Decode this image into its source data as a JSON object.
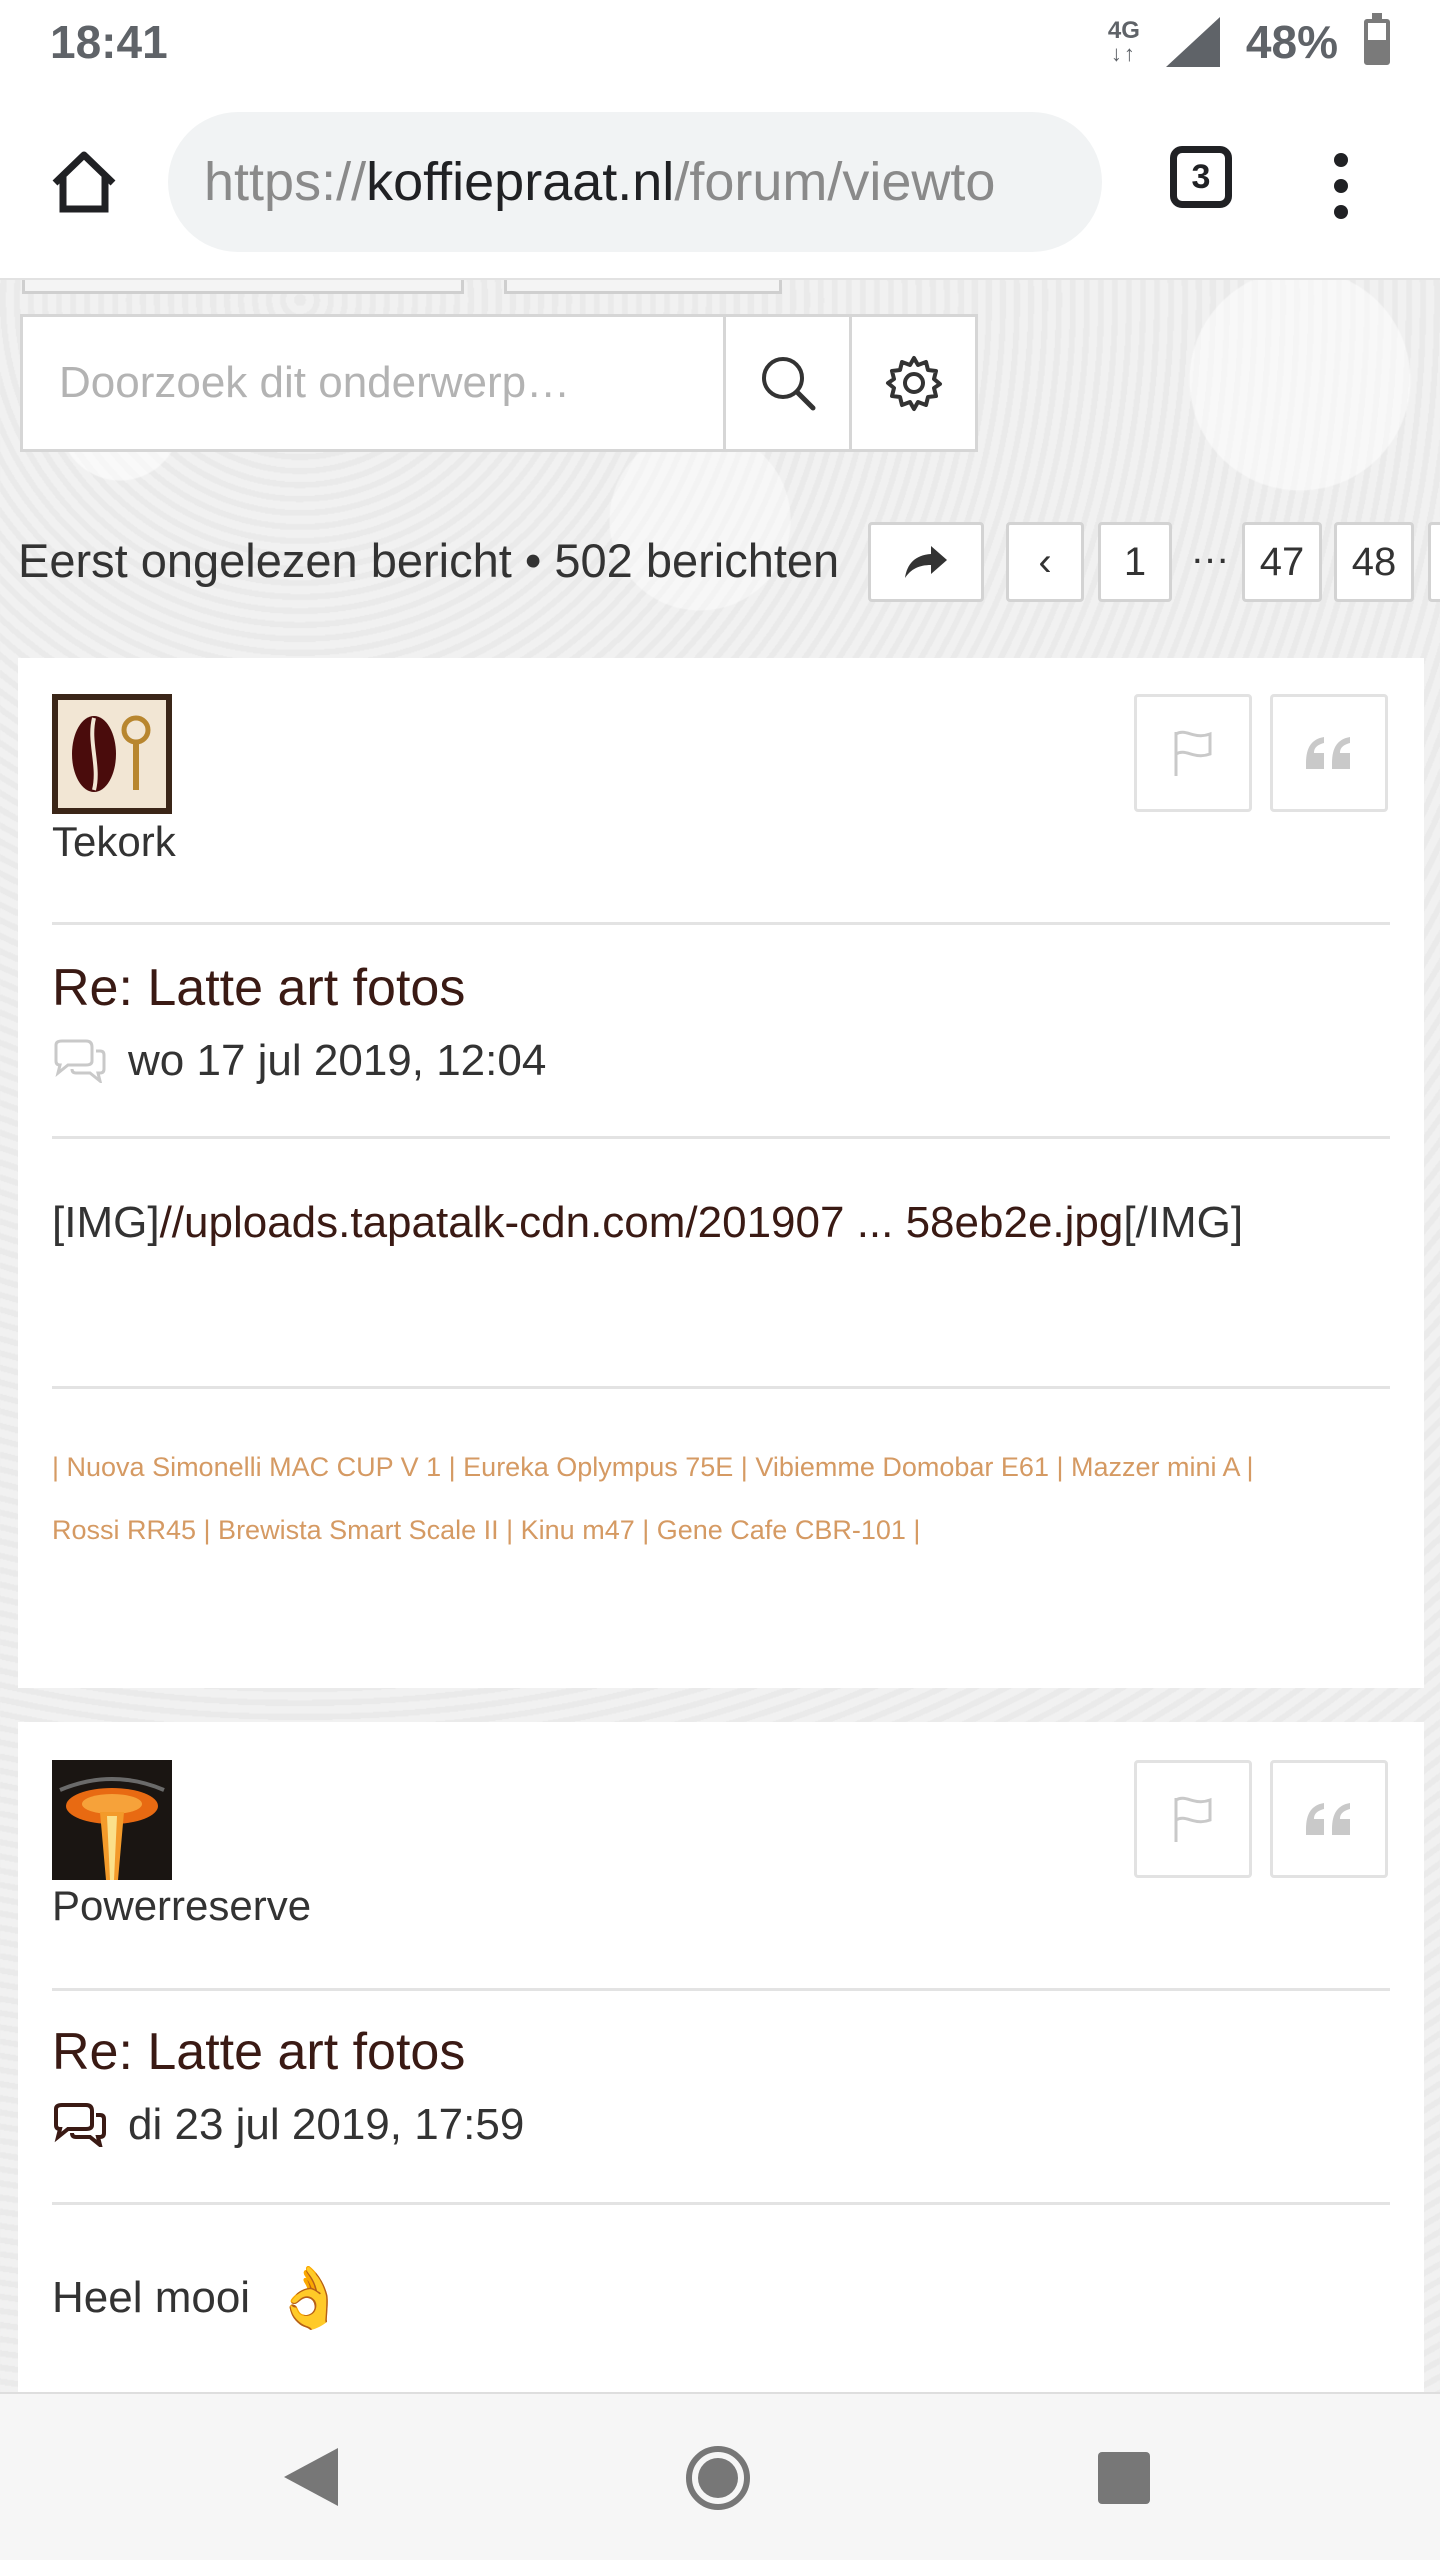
{
  "status_bar": {
    "time": "18:41",
    "network": "4G",
    "battery": "48%"
  },
  "browser": {
    "url_scheme": "https://",
    "url_host": "koffiepraat.nl",
    "url_path": "/forum/viewto",
    "tab_count": "3"
  },
  "search": {
    "placeholder": "Doorzoek dit onderwerp…"
  },
  "pagination": {
    "stats": "Eerst ongelezen bericht • 502 berichten",
    "prev_label": "‹",
    "pages": [
      "1",
      "47",
      "48"
    ],
    "ellipsis": "…"
  },
  "posts": [
    {
      "username": "Tekork",
      "title": "Re: Latte art fotos",
      "date": "wo 17 jul 2019, 12:04",
      "body_prefix": "[IMG]",
      "body_link": "//uploads.tapatalk-cdn.com/201907 ... 58eb2e.jpg",
      "body_suffix": "[/IMG]",
      "signature_line1": "| Nuova Simonelli MAC CUP V 1 | Eureka Oplympus 75E | Vibiemme Domobar E61 | Mazzer mini A |",
      "signature_line2": "Rossi RR45 | Brewista Smart Scale II | Kinu m47 | Gene Cafe CBR-101 |"
    },
    {
      "username": "Powerreserve",
      "title": "Re: Latte art fotos",
      "date": "di 23 jul 2019, 17:59",
      "body": "Heel mooi",
      "emoji": "👌"
    }
  ],
  "colors": {
    "title_brown": "#3a1a14",
    "signature_orange": "#d59a63",
    "text_dark": "#333333"
  },
  "icons": {
    "home": "home-icon",
    "search": "search-icon",
    "settings": "gear-icon",
    "share": "share-arrow-icon",
    "report": "flag-icon",
    "quote": "quote-icon",
    "post": "speech-bubbles-icon"
  }
}
